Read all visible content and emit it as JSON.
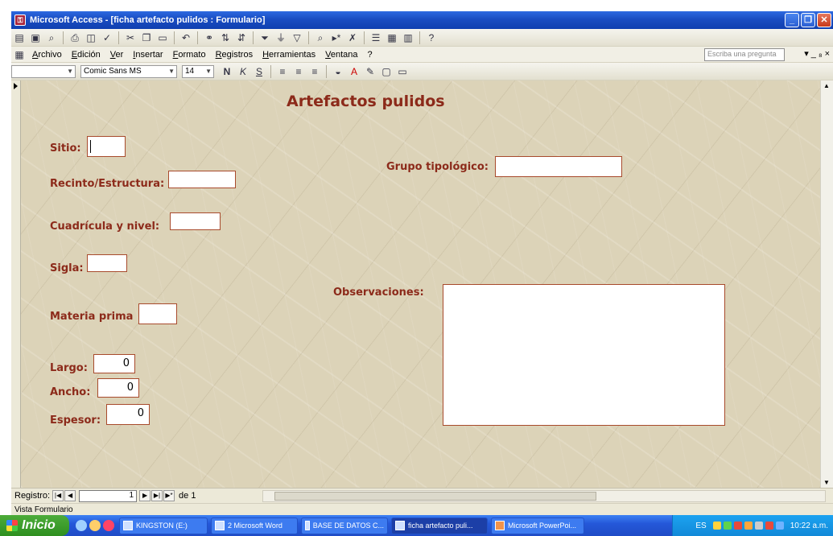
{
  "window": {
    "title": "Microsoft Access - [ficha artefacto pulidos : Formulario]",
    "app_icon": "access-icon"
  },
  "toolbar1": {
    "icons": [
      "view-icon",
      "save-icon",
      "search-file-icon",
      "print-icon",
      "preview-icon",
      "spell-icon",
      "cut-icon",
      "copy-icon",
      "paste-icon",
      "undo-icon",
      "hyperlink-icon",
      "sort-asc-icon",
      "sort-desc-icon",
      "filter-selection-icon",
      "filter-form-icon",
      "apply-filter-icon",
      "find-icon",
      "new-record-icon",
      "delete-record-icon",
      "properties-icon",
      "database-window-icon",
      "new-object-icon",
      "help-icon"
    ]
  },
  "menubar": {
    "items": [
      "Archivo",
      "Edición",
      "Ver",
      "Insertar",
      "Formato",
      "Registros",
      "Herramientas",
      "Ventana",
      "?"
    ],
    "help_placeholder": "Escriba una pregunta",
    "right": "▾ _ ₈ ×"
  },
  "format_toolbar": {
    "object": "",
    "font": "Comic Sans MS",
    "size": "14"
  },
  "form": {
    "title": "Artefactos pulidos",
    "labels": {
      "sitio": "Sitio:",
      "recinto": "Recinto/Estructura:",
      "cuadricula": "Cuadrícula y nivel:",
      "sigla": "Sigla:",
      "materia": "Materia prima",
      "largo": "Largo:",
      "ancho": "Ancho:",
      "espesor": "Espesor:",
      "grupo": "Grupo tipológico:",
      "observaciones": "Observaciones:"
    },
    "values": {
      "sitio": "",
      "recinto": "",
      "cuadricula": "",
      "sigla": "",
      "materia": "",
      "largo": "0",
      "ancho": "0",
      "espesor": "0",
      "grupo": "",
      "observaciones": ""
    }
  },
  "record_nav": {
    "label": "Registro:",
    "current": "1",
    "of": "de 1"
  },
  "status": "Vista Formulario",
  "taskbar": {
    "start": "Inicio",
    "tasks": [
      "KINGSTON (E:)",
      "2 Microsoft Word",
      "BASE DE DATOS C...",
      "ficha artefacto puli...",
      "Microsoft PowerPoi..."
    ],
    "lang": "ES",
    "clock": "10:22 a.m."
  }
}
